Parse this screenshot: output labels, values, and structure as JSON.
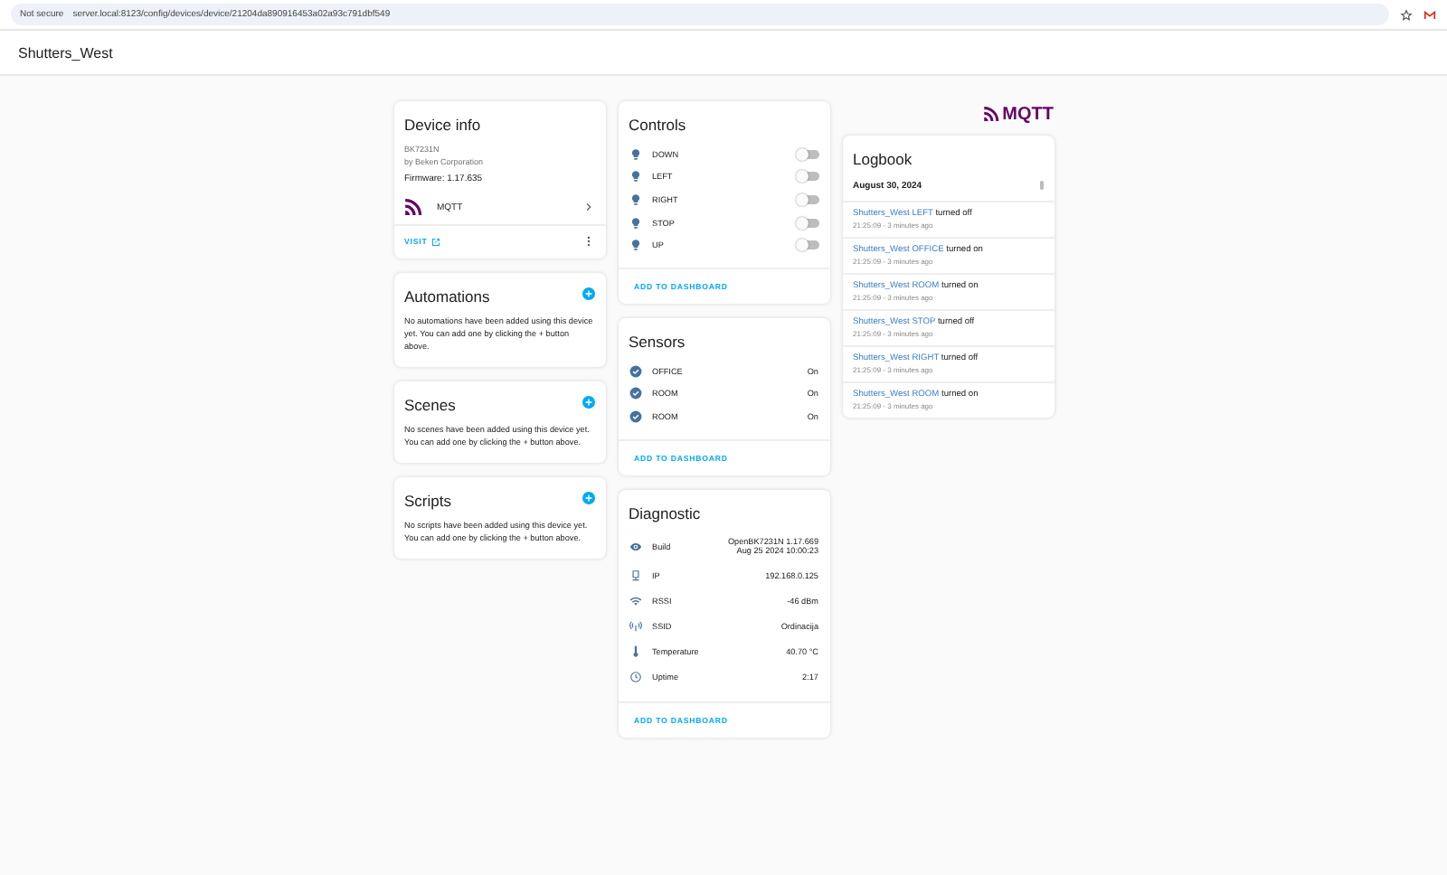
{
  "browser": {
    "security": "Not secure",
    "url": "server.local:8123/config/devices/device/21204da890916453a02a93c791dbf549"
  },
  "header": {
    "title": "Shutters_West"
  },
  "integration_logo": {
    "text": "MQTT"
  },
  "device_info": {
    "title": "Device info",
    "model": "BK7231N",
    "manufacturer": "by Beken Corporation",
    "firmware": "Firmware: 1.17.635",
    "integration": "MQTT",
    "visit": "VISIT"
  },
  "automations": {
    "title": "Automations",
    "text": "No automations have been added using this device yet. You can add one by clicking the + button above."
  },
  "scenes": {
    "title": "Scenes",
    "text": "No scenes have been added using this device yet. You can add one by clicking the + button above."
  },
  "scripts": {
    "title": "Scripts",
    "text": "No scripts have been added using this device yet. You can add one by clicking the + button above."
  },
  "controls": {
    "title": "Controls",
    "items": [
      {
        "name": "DOWN",
        "on": false
      },
      {
        "name": "LEFT",
        "on": false
      },
      {
        "name": "RIGHT",
        "on": false
      },
      {
        "name": "STOP",
        "on": false
      },
      {
        "name": "UP",
        "on": false
      }
    ],
    "action": "ADD TO DASHBOARD"
  },
  "sensors": {
    "title": "Sensors",
    "items": [
      {
        "name": "OFFICE",
        "value": "On"
      },
      {
        "name": "ROOM",
        "value": "On"
      },
      {
        "name": "ROOM",
        "value": "On"
      }
    ],
    "action": "ADD TO DASHBOARD"
  },
  "diagnostic": {
    "title": "Diagnostic",
    "items": [
      {
        "kind": "build",
        "name": "Build",
        "value": "OpenBK7231N 1.17.669",
        "value_2": "Aug 25 2024 10:00:23"
      },
      {
        "kind": "ip",
        "name": "IP",
        "value": "192.168.0.125"
      },
      {
        "kind": "rssi",
        "name": "RSSI",
        "value": "-46 dBm"
      },
      {
        "kind": "ssid",
        "name": "SSID",
        "value": "Ordinacija"
      },
      {
        "kind": "temperature",
        "name": "Temperature",
        "value": "40.70 °C"
      },
      {
        "kind": "uptime",
        "name": "Uptime",
        "value": "2:17"
      }
    ],
    "action": "ADD TO DASHBOARD"
  },
  "logbook": {
    "title": "Logbook",
    "date": "August 30, 2024",
    "entries": [
      {
        "entity": "Shutters_West LEFT",
        "action": "turned off",
        "time": "21:25:09 - 3 minutes ago"
      },
      {
        "entity": "Shutters_West OFFICE",
        "action": "turned on",
        "time": "21:25:09 - 3 minutes ago"
      },
      {
        "entity": "Shutters_West ROOM",
        "action": "turned on",
        "time": "21:25:09 - 3 minutes ago"
      },
      {
        "entity": "Shutters_West STOP",
        "action": "turned off",
        "time": "21:25:09 - 3 minutes ago"
      },
      {
        "entity": "Shutters_West RIGHT",
        "action": "turned off",
        "time": "21:25:09 - 3 minutes ago"
      },
      {
        "entity": "Shutters_West ROOM",
        "action": "turned on",
        "time": "21:25:09 - 3 minutes ago"
      }
    ]
  }
}
